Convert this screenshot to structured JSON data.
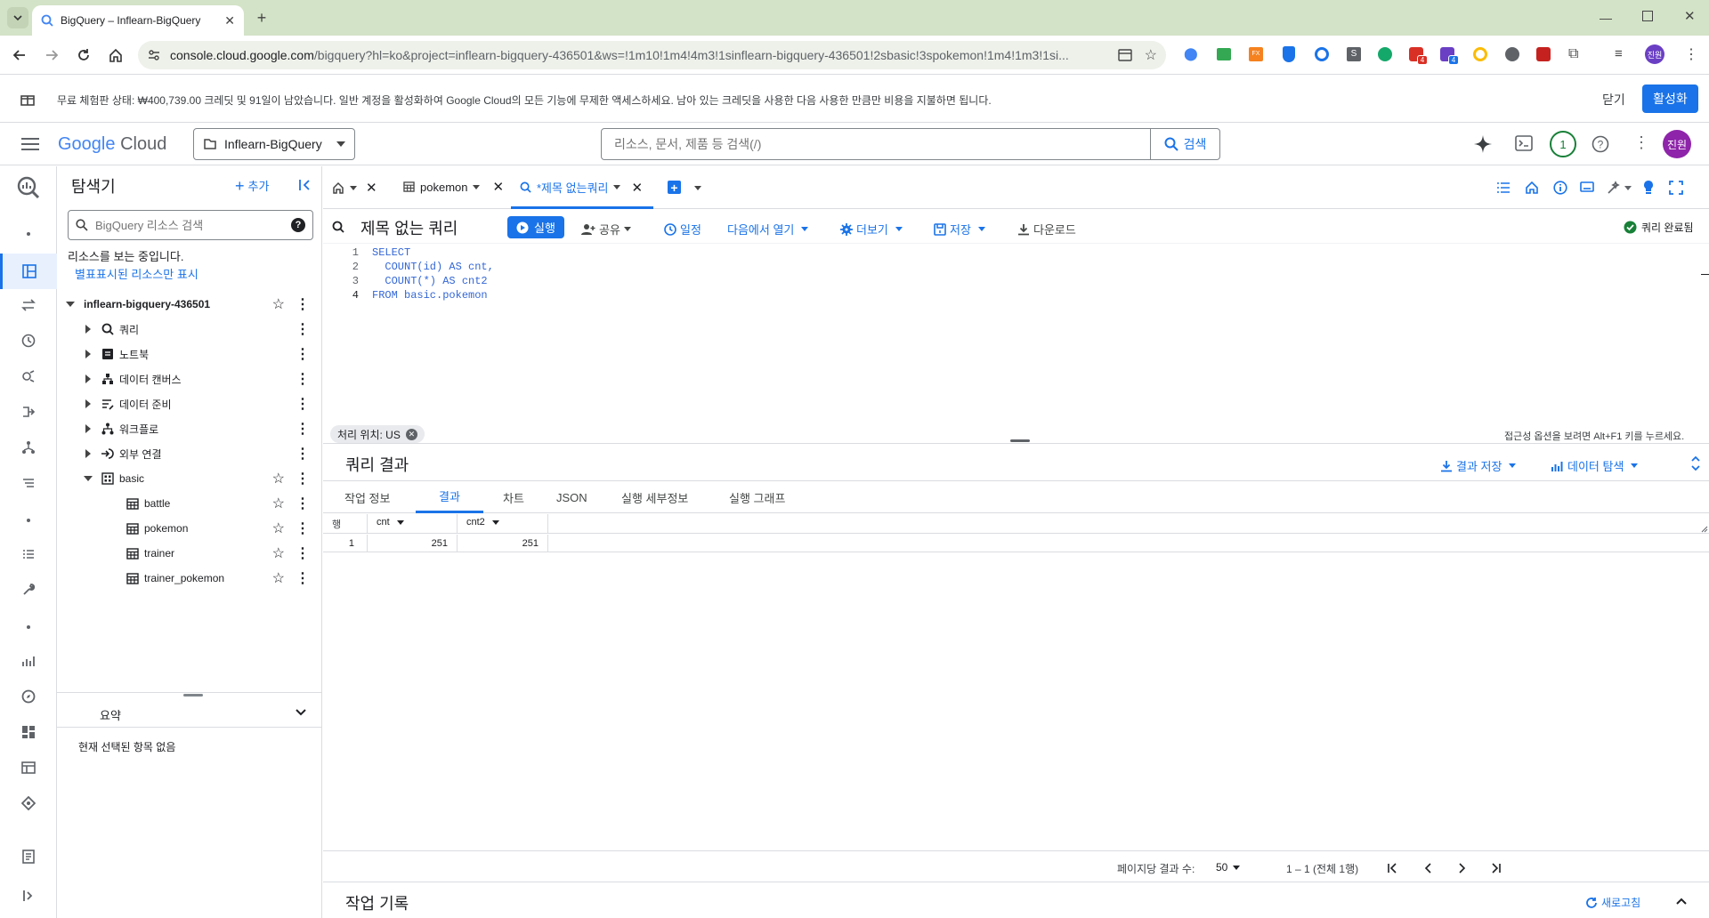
{
  "browser": {
    "tab_title": "BigQuery – Inflearn-BigQuery",
    "url_host": "console.cloud.google.com",
    "url_rest": "/bigquery?hl=ko&project=inflearn-bigquery-436501&ws=!1m10!1m4!4m3!1sinflearn-bigquery-436501!2sbasic!3spokemon!1m4!1m3!1si...",
    "ext_badge_1": "4",
    "ext_badge_2": "4",
    "profile": "진원"
  },
  "banner": {
    "text": "무료 체험판 상태: ₩400,739.00 크레딧 및 91일이 남았습니다. 일반 계정을 활성화하여 Google Cloud의 모든 기능에 무제한 액세스하세요. 남아 있는 크레딧을 사용한 다음 사용한 만큼만 비용을 지불하면 됩니다.",
    "close": "닫기",
    "activate": "활성화"
  },
  "header": {
    "logo_google": "Google",
    "logo_cloud": "Cloud",
    "project": "Inflearn-BigQuery",
    "search_placeholder": "리소스, 문서, 제품 등 검색(/)",
    "search_button": "검색",
    "notification_count": "1",
    "avatar": "진원"
  },
  "explorer": {
    "title": "탐색기",
    "add": "추가",
    "search_placeholder": "BigQuery 리소스 검색",
    "viewing": "리소스를 보는 중입니다.",
    "starred_only": "별표표시된 리소스만 표시",
    "project": "inflearn-bigquery-436501",
    "items": [
      {
        "label": "쿼리",
        "icon": "query-icon"
      },
      {
        "label": "노트북",
        "icon": "notebook-icon"
      },
      {
        "label": "데이터 캔버스",
        "icon": "canvas-icon"
      },
      {
        "label": "데이터 준비",
        "icon": "data-prep-icon"
      },
      {
        "label": "워크플로",
        "icon": "workflow-icon"
      },
      {
        "label": "외부 연결",
        "icon": "connection-icon"
      }
    ],
    "dataset": "basic",
    "tables": [
      "battle",
      "pokemon",
      "trainer",
      "trainer_pokemon"
    ],
    "summary_title": "요약",
    "summary_empty": "현재 선택된 항목 없음"
  },
  "editor_tabs": {
    "tab1": "pokemon",
    "tab2": "*제목 없는쿼리"
  },
  "query": {
    "title": "제목 없는 쿼리",
    "run": "실행",
    "share": "공유",
    "schedule": "일정",
    "open_in": "다음에서 열기",
    "more": "더보기",
    "save": "저장",
    "download": "다운로드",
    "status": "쿼리 완료됨",
    "lines": [
      {
        "n": "1",
        "code": "SELECT"
      },
      {
        "n": "2",
        "code": "  COUNT(id) AS cnt,"
      },
      {
        "n": "3",
        "code": "  COUNT(*) AS cnt2"
      },
      {
        "n": "4",
        "code": "FROM basic.pokemon"
      }
    ],
    "location": "처리 위치: US",
    "accessibility": "접근성 옵션을 보려면 Alt+F1 키를 누르세요."
  },
  "results": {
    "title": "쿼리 결과",
    "save_results": "결과 저장",
    "explore_data": "데이터 탐색",
    "tabs": [
      "작업 정보",
      "결과",
      "차트",
      "JSON",
      "실행 세부정보",
      "실행 그래프"
    ],
    "active_tab": "결과",
    "columns": [
      "행",
      "cnt",
      "cnt2"
    ],
    "rows": [
      [
        "1",
        "251",
        "251"
      ]
    ],
    "per_page_label": "페이지당 결과 수:",
    "per_page": "50",
    "range": "1 – 1 (전체 1행)"
  },
  "history": {
    "title": "작업 기록",
    "refresh": "새로고침"
  },
  "colors": {
    "accent": "#1a73e8",
    "tab_bg": "#d3e3c7",
    "success": "#188038"
  }
}
